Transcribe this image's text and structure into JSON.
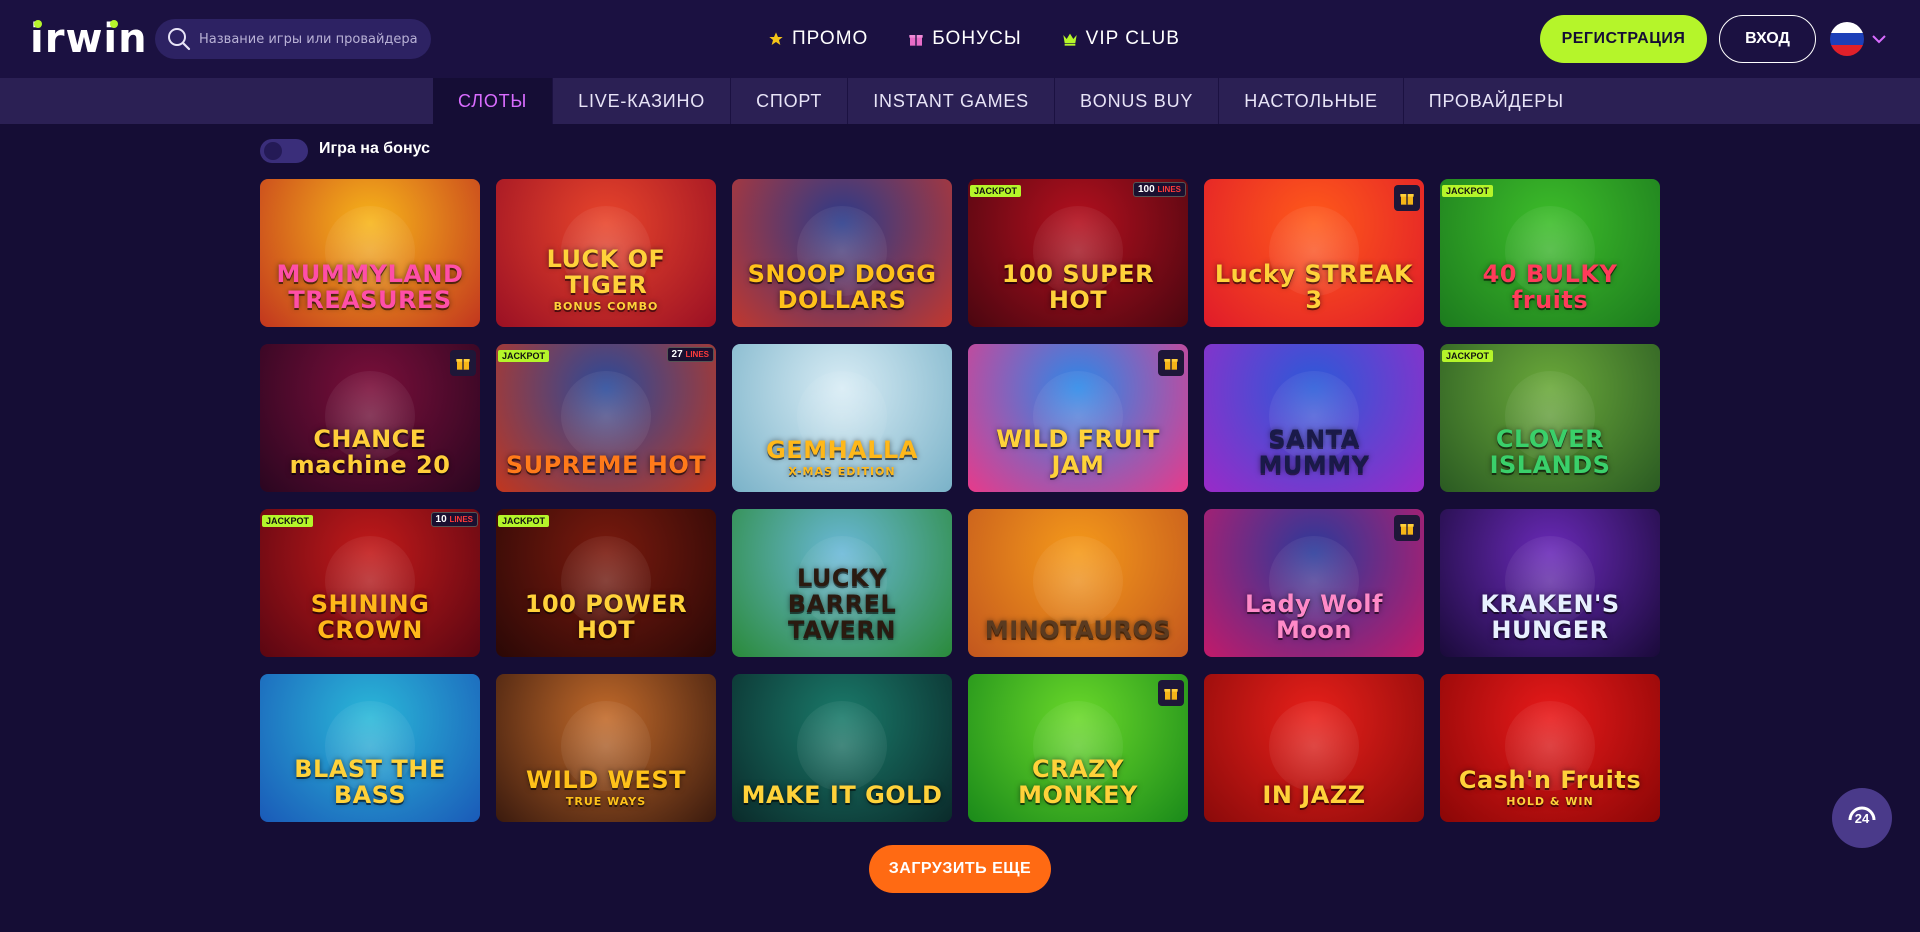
{
  "header": {
    "logo": "irwin",
    "search_placeholder": "Название игры или провайдера",
    "nav": [
      {
        "label": "ПРОМО",
        "icon": "star-icon",
        "icon_color": "#f5c518"
      },
      {
        "label": "БОНУСЫ",
        "icon": "gift-icon",
        "icon_color": "#e86cc8"
      },
      {
        "label": "VIP CLUB",
        "icon": "crown-icon",
        "icon_color": "#b5f52a"
      }
    ],
    "register_label": "РЕГИСТРАЦИЯ",
    "login_label": "ВХОД",
    "language_icon": "russia-flag-icon"
  },
  "categories": [
    {
      "label": "СЛОТЫ",
      "active": true
    },
    {
      "label": "LIVE-КАЗИНО",
      "active": false
    },
    {
      "label": "СПОРТ",
      "active": false
    },
    {
      "label": "INSTANT GAMES",
      "active": false
    },
    {
      "label": "BONUS BUY",
      "active": false
    },
    {
      "label": "НАСТОЛЬНЫЕ",
      "active": false
    },
    {
      "label": "ПРОВАЙДЕРЫ",
      "active": false
    }
  ],
  "bonus_toggle": {
    "label": "Игра на бонус",
    "on": false
  },
  "games": [
    {
      "title": "MUMMYLAND TREASURES",
      "sub": "",
      "bg": [
        "#f7b51a",
        "#c2361e"
      ],
      "color": "#ff4fa8",
      "jackpot": false,
      "lines": "",
      "gift": false
    },
    {
      "title": "LUCK OF TIGER",
      "sub": "BONUS COMBO",
      "bg": [
        "#e8452b",
        "#9a1024"
      ],
      "color": "#ffd23a",
      "jackpot": false,
      "lines": "",
      "gift": false
    },
    {
      "title": "SNOOP DOGG DOLLARS",
      "sub": "",
      "bg": [
        "#2a3b8a",
        "#c2372e"
      ],
      "color": "#ffc21a",
      "jackpot": false,
      "lines": "",
      "gift": false
    },
    {
      "title": "100 SUPER HOT",
      "sub": "",
      "bg": [
        "#b3101e",
        "#4a0610"
      ],
      "color": "#ffd23a",
      "jackpot": true,
      "lines": "100",
      "gift": false
    },
    {
      "title": "Lucky STREAK 3",
      "sub": "",
      "bg": [
        "#ff5a1a",
        "#e01b2a"
      ],
      "color": "#ffd23a",
      "jackpot": false,
      "lines": "",
      "gift": true
    },
    {
      "title": "40 BULKY fruits",
      "sub": "",
      "bg": [
        "#3dbd2a",
        "#1c7a1e"
      ],
      "color": "#ff3b5a",
      "jackpot": true,
      "lines": "",
      "gift": false
    },
    {
      "title": "CHANCE machine 20",
      "sub": "",
      "bg": [
        "#7a0f3a",
        "#2a0620"
      ],
      "color": "#ffcf3a",
      "jackpot": false,
      "lines": "",
      "gift": true
    },
    {
      "title": "SUPREME HOT",
      "sub": "",
      "bg": [
        "#2a4a9a",
        "#c2361e"
      ],
      "color": "#ff7a1a",
      "jackpot": true,
      "lines": "27",
      "gift": false
    },
    {
      "title": "GEMHALLA",
      "sub": "X-MAS EDITION",
      "bg": [
        "#d8ecf5",
        "#7ab2c8"
      ],
      "color": "#ffb81a",
      "jackpot": false,
      "lines": "",
      "gift": false
    },
    {
      "title": "WILD FRUIT JAM",
      "sub": "",
      "bg": [
        "#2b88e8",
        "#e83a8a"
      ],
      "color": "#ffd23a",
      "jackpot": false,
      "lines": "",
      "gift": true
    },
    {
      "title": "SANTA MUMMY",
      "sub": "",
      "bg": [
        "#2a5ad8",
        "#9a2ac8"
      ],
      "color": "#1a1a4a",
      "jackpot": false,
      "lines": "",
      "gift": false
    },
    {
      "title": "CLOVER ISLANDS",
      "sub": "",
      "bg": [
        "#6aa83a",
        "#2a5a22"
      ],
      "color": "#3ad06a",
      "jackpot": true,
      "lines": "",
      "gift": false
    },
    {
      "title": "SHINING CROWN",
      "sub": "",
      "bg": [
        "#c21a1a",
        "#5a0612"
      ],
      "color": "#ffb81a",
      "jackpot": true,
      "lines": "10",
      "gift": false
    },
    {
      "title": "100 POWER HOT",
      "sub": "",
      "bg": [
        "#7a1a0e",
        "#2a0806"
      ],
      "color": "#ffd23a",
      "jackpot": true,
      "lines": "",
      "gift": false
    },
    {
      "title": "LUCKY BARREL TAVERN",
      "sub": "",
      "bg": [
        "#6ab8d8",
        "#2a8a3a"
      ],
      "color": "#2a1a10",
      "jackpot": false,
      "lines": "",
      "gift": false
    },
    {
      "title": "MINOTAUROS",
      "sub": "",
      "bg": [
        "#f59a1a",
        "#c2561e"
      ],
      "color": "#5a3a20",
      "jackpot": false,
      "lines": "",
      "gift": false
    },
    {
      "title": "Lady Wolf Moon",
      "sub": "",
      "bg": [
        "#2a3a9a",
        "#c21a6a"
      ],
      "color": "#ff8ac8",
      "jackpot": false,
      "lines": "",
      "gift": true
    },
    {
      "title": "KRAKEN'S HUNGER",
      "sub": "",
      "bg": [
        "#6a2ab8",
        "#1a0a3a"
      ],
      "color": "#e8f0ff",
      "jackpot": false,
      "lines": "",
      "gift": false
    },
    {
      "title": "BLAST THE BASS",
      "sub": "",
      "bg": [
        "#2ab8d8",
        "#1a5ab8"
      ],
      "color": "#ffd23a",
      "jackpot": false,
      "lines": "",
      "gift": false
    },
    {
      "title": "WILD WEST",
      "sub": "TRUE WAYS",
      "bg": [
        "#c26a2a",
        "#3a1a0e"
      ],
      "color": "#ffc21a",
      "jackpot": false,
      "lines": "",
      "gift": false
    },
    {
      "title": "MAKE IT GOLD",
      "sub": "",
      "bg": [
        "#1a7a6a",
        "#0a2a2a"
      ],
      "color": "#ffd23a",
      "jackpot": false,
      "lines": "",
      "gift": false
    },
    {
      "title": "CRAZY MONKEY",
      "sub": "",
      "bg": [
        "#6ad82a",
        "#1a8a1a"
      ],
      "color": "#ffd23a",
      "jackpot": false,
      "lines": "",
      "gift": true
    },
    {
      "title": "IN JAZZ",
      "sub": "",
      "bg": [
        "#e8201a",
        "#8a0a0a"
      ],
      "color": "#ffd23a",
      "jackpot": false,
      "lines": "",
      "gift": false
    },
    {
      "title": "Cash'n Fruits",
      "sub": "HOLD & WIN",
      "bg": [
        "#e81a1a",
        "#8a0606"
      ],
      "color": "#ffd23a",
      "jackpot": false,
      "lines": "",
      "gift": false
    }
  ],
  "badges": {
    "jackpot": "JACKPOT",
    "lines_suffix": "LINES"
  },
  "load_more_label": "ЗАГРУЗИТЬ ЕЩЕ",
  "support_label": "24",
  "colors": {
    "background": "#150d35",
    "header_bg": "#1b1141",
    "accent_green": "#b5f52a",
    "accent_orange": "#ff6a13",
    "active_tab": "#d96cff"
  }
}
